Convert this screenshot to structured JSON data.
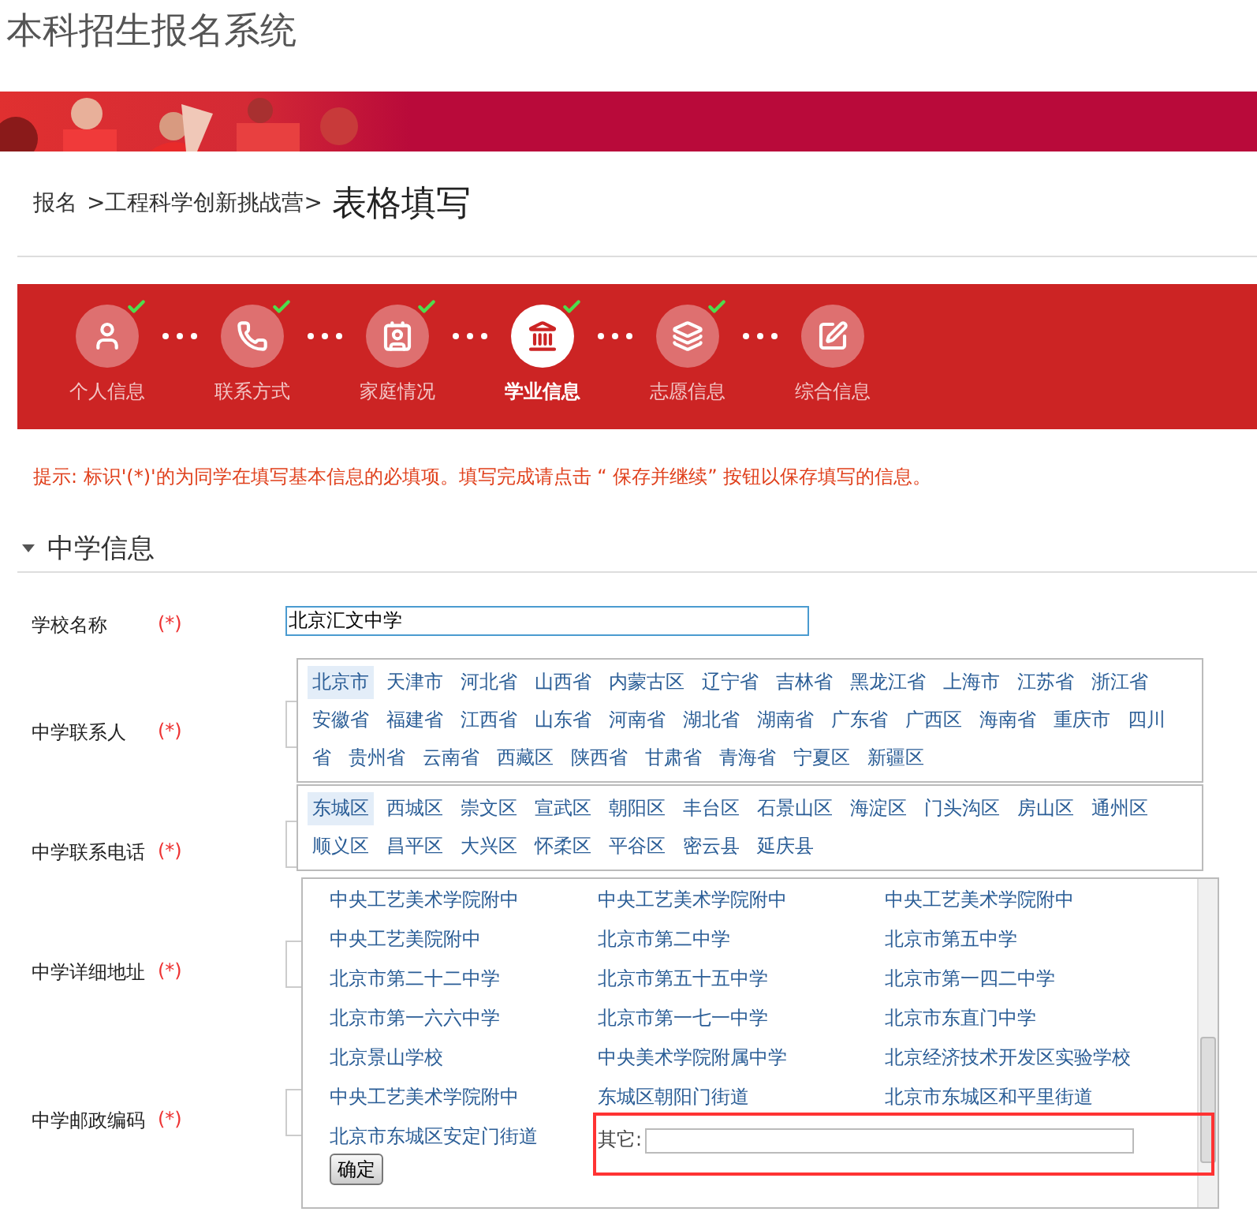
{
  "site_title": "本科招生报名系统",
  "breadcrumb": {
    "links": [
      "报名",
      ">工程科学创新挑战营>"
    ],
    "current": "表格填写"
  },
  "steps": [
    {
      "label": "个人信息",
      "done": true,
      "selected": false
    },
    {
      "label": "联系方式",
      "done": true,
      "selected": false
    },
    {
      "label": "家庭情况",
      "done": true,
      "selected": false
    },
    {
      "label": "学业信息",
      "done": true,
      "selected": true
    },
    {
      "label": "志愿信息",
      "done": true,
      "selected": false
    },
    {
      "label": "综合信息",
      "done": false,
      "selected": false
    }
  ],
  "notice": "提示: 标识'(*)'的为同学在填写基本信息的必填项。填写完成请点击 “ 保存并继续” 按钮以保存填写的信息。",
  "section": {
    "title": "中学信息",
    "expanded": true
  },
  "fields": [
    {
      "label": "学校名称",
      "required": "(*)",
      "value": "北京汇文中学"
    },
    {
      "label": "中学联系人",
      "required": "(*)"
    },
    {
      "label": "中学联系电话",
      "required": "(*)"
    },
    {
      "label": "中学详细地址",
      "required": "(*)"
    },
    {
      "label": "中学邮政编码",
      "required": "(*)"
    }
  ],
  "provinces": [
    {
      "label": "北京市",
      "selected": true
    },
    {
      "label": "天津市",
      "selected": false
    },
    {
      "label": "河北省",
      "selected": false
    },
    {
      "label": "山西省",
      "selected": false
    },
    {
      "label": "内蒙古区",
      "selected": false
    },
    {
      "label": "辽宁省",
      "selected": false
    },
    {
      "label": "吉林省",
      "selected": false
    },
    {
      "label": "黑龙江省",
      "selected": false
    },
    {
      "label": "上海市",
      "selected": false
    },
    {
      "label": "江苏省",
      "selected": false
    },
    {
      "label": "浙江省",
      "selected": false
    },
    {
      "label": "安徽省",
      "selected": false
    },
    {
      "label": "福建省",
      "selected": false
    },
    {
      "label": "江西省",
      "selected": false
    },
    {
      "label": "山东省",
      "selected": false
    },
    {
      "label": "河南省",
      "selected": false
    },
    {
      "label": "湖北省",
      "selected": false
    },
    {
      "label": "湖南省",
      "selected": false
    },
    {
      "label": "广东省",
      "selected": false
    },
    {
      "label": "广西区",
      "selected": false
    },
    {
      "label": "海南省",
      "selected": false
    },
    {
      "label": "重庆市",
      "selected": false
    },
    {
      "label": "四川",
      "selected": false
    },
    {
      "label": "省",
      "selected": false
    },
    {
      "label": "贵州省",
      "selected": false
    },
    {
      "label": "云南省",
      "selected": false
    },
    {
      "label": "西藏区",
      "selected": false
    },
    {
      "label": "陕西省",
      "selected": false
    },
    {
      "label": "甘肃省",
      "selected": false
    },
    {
      "label": "青海省",
      "selected": false
    },
    {
      "label": "宁夏区",
      "selected": false
    },
    {
      "label": "新疆区",
      "selected": false
    }
  ],
  "districts": [
    {
      "label": "东城区",
      "selected": true
    },
    {
      "label": "西城区",
      "selected": false
    },
    {
      "label": "崇文区",
      "selected": false
    },
    {
      "label": "宣武区",
      "selected": false
    },
    {
      "label": "朝阳区",
      "selected": false
    },
    {
      "label": "丰台区",
      "selected": false
    },
    {
      "label": "石景山区",
      "selected": false
    },
    {
      "label": "海淀区",
      "selected": false
    },
    {
      "label": "门头沟区",
      "selected": false
    },
    {
      "label": "房山区",
      "selected": false
    },
    {
      "label": "通州区",
      "selected": false
    },
    {
      "label": "顺义区",
      "selected": false
    },
    {
      "label": "昌平区",
      "selected": false
    },
    {
      "label": "大兴区",
      "selected": false
    },
    {
      "label": "怀柔区",
      "selected": false
    },
    {
      "label": "平谷区",
      "selected": false
    },
    {
      "label": "密云县",
      "selected": false
    },
    {
      "label": "延庆县",
      "selected": false
    }
  ],
  "schools": [
    "中央工艺美术学院附中",
    "中央工艺美术学院附中",
    "中央工艺美术学院附中",
    "中央工艺美院附中",
    "北京市第二中学",
    "北京市第五中学",
    "北京市第二十二中学",
    "北京市第五十五中学",
    "北京市第一四二中学",
    "北京市第一六六中学",
    "北京市第一七一中学",
    "北京市东直门中学",
    "北京景山学校",
    "中央美术学院附属中学",
    "北京经济技术开发区实验学校",
    "中央工艺美术学院附中",
    "东城区朝阳门街道",
    "北京市东城区和平里街道",
    "北京市东城区安定门街道"
  ],
  "other": {
    "label": "其它:"
  },
  "confirm_button": "确定"
}
